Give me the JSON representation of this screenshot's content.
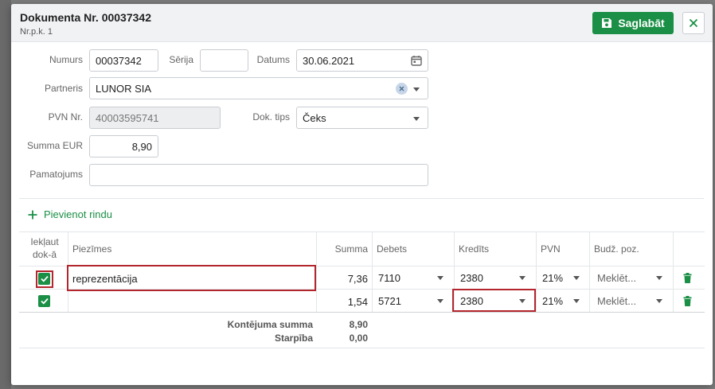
{
  "header": {
    "title": "Dokumenta Nr. 00037342",
    "subtitle": "Nr.p.k. 1",
    "save_label": "Saglabāt"
  },
  "form": {
    "numurs": {
      "label": "Numurs",
      "value": "00037342"
    },
    "serija": {
      "label": "Sērija",
      "value": ""
    },
    "datums": {
      "label": "Datums",
      "value": "30.06.2021"
    },
    "partneris": {
      "label": "Partneris",
      "value": "LUNOR SIA"
    },
    "pvn_nr": {
      "label": "PVN Nr.",
      "value": "40003595741"
    },
    "dok_tips": {
      "label": "Dok. tips",
      "value": "Čeks"
    },
    "summa": {
      "label": "Summa EUR",
      "value": "8,90"
    },
    "pamatojums": {
      "label": "Pamatojums",
      "value": ""
    }
  },
  "add_row_label": "Pievienot rindu",
  "table": {
    "columns": {
      "include_line1": "Iekļaut",
      "include_line2": "dok-ā",
      "notes": "Piezīmes",
      "amount": "Summa",
      "debit": "Debets",
      "credit": "Kredīts",
      "vat": "PVN",
      "budget": "Budž. poz."
    },
    "rows": [
      {
        "notes": "reprezentācija",
        "amount": "7,36",
        "debit": "7110",
        "credit": "2380",
        "vat": "21%",
        "budget": "Meklēt..."
      },
      {
        "notes": "",
        "amount": "1,54",
        "debit": "5721",
        "credit": "2380",
        "vat": "21%",
        "budget": "Meklēt..."
      }
    ],
    "footer": {
      "total_label": "Kontējuma summa",
      "total_value": "8,90",
      "diff_label": "Starpība",
      "diff_value": "0,00"
    }
  },
  "colors": {
    "accent": "#1a8f45",
    "highlight": "#b3262d"
  }
}
